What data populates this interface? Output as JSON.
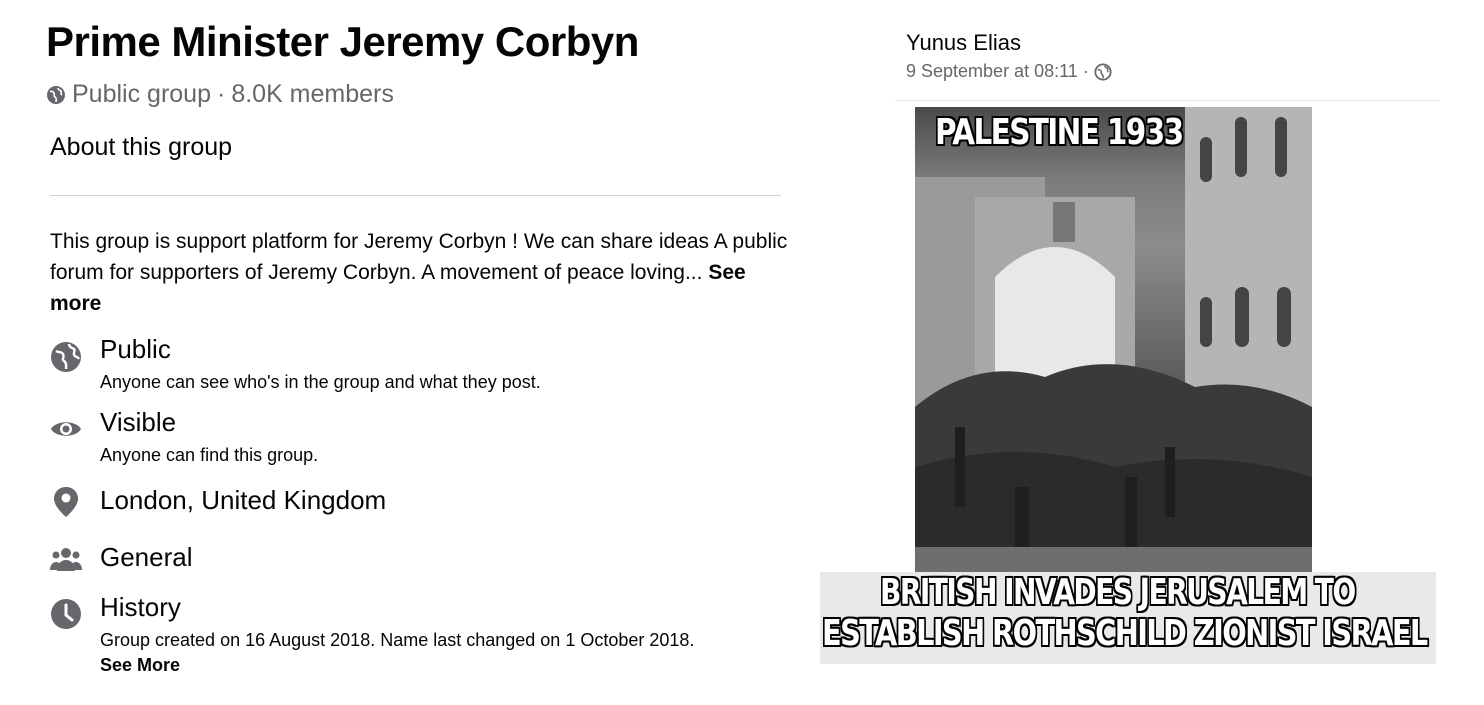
{
  "group": {
    "title": "Prime Minister Jeremy Corbyn",
    "privacy": "Public group",
    "separator": "·",
    "members": "8.0K members"
  },
  "about": {
    "heading": "About this group",
    "description": "This group is support platform for Jeremy Corbyn ! We can share ideas A public forum for supporters of Jeremy Corbyn. A movement of peace loving...",
    "see_more": "See more",
    "items": [
      {
        "icon": "globe-icon",
        "title": "Public",
        "subtitle": "Anyone can see who's in the group and what they post."
      },
      {
        "icon": "eye-icon",
        "title": "Visible",
        "subtitle": "Anyone can find this group."
      },
      {
        "icon": "location-pin-icon",
        "title": "London, United Kingdom"
      },
      {
        "icon": "people-icon",
        "title": "General"
      },
      {
        "icon": "clock-icon",
        "title": "History",
        "subtitle": "Group created on 16 August 2018. Name last changed on 1 October 2018.",
        "more": "See More"
      }
    ]
  },
  "post": {
    "author": "Yunus Elias",
    "time": "9 September at 08:11 ·",
    "image_caption_top": "PALESTINE 1933",
    "image_caption_bottom_1": "BRITISH INVADES JERUSALEM TO",
    "image_caption_bottom_2": "ESTABLISH ROTHSCHILD ZIONIST ISRAEL"
  },
  "colors": {
    "secondary_text": "#65676b",
    "icon_gray": "#65676b",
    "divider": "#ced0d4"
  }
}
